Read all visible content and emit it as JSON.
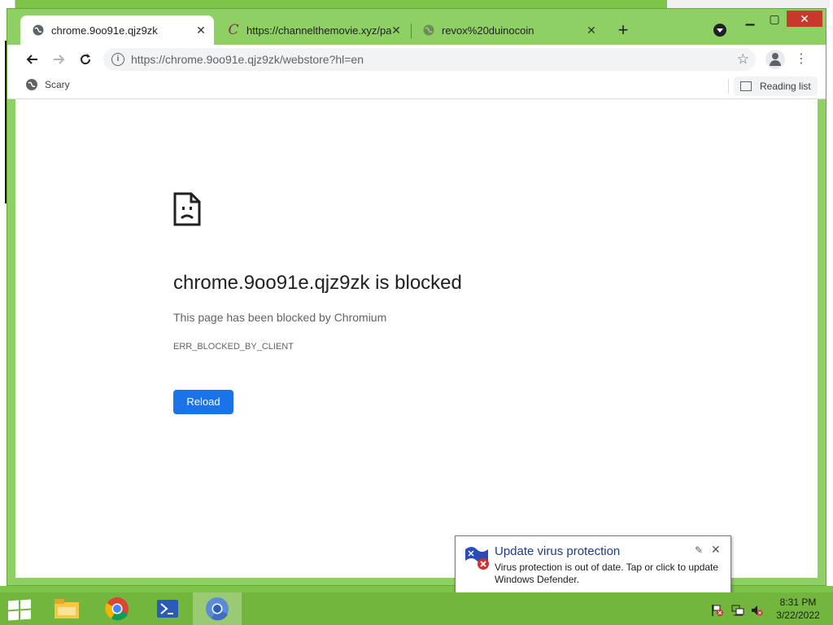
{
  "tabs": [
    {
      "title": "chrome.9oo91e.qjz9zk",
      "active": true,
      "favicon": "globe-icon"
    },
    {
      "title": "https://channelthemovie.xyz/pag",
      "active": false,
      "favicon": "channel-c-icon"
    },
    {
      "title": "revox%20duinocoin",
      "active": false,
      "favicon": "globe-icon"
    }
  ],
  "toolbar": {
    "url": "https://chrome.9oo91e.qjz9zk/webstore?hl=en"
  },
  "bookmarks": {
    "item": "Scary",
    "reading_list": "Reading list"
  },
  "error": {
    "title": "chrome.9oo91e.qjz9zk is blocked",
    "description": "This page has been blocked by Chromium",
    "code": "ERR_BLOCKED_BY_CLIENT",
    "reload_label": "Reload"
  },
  "notification": {
    "title": "Update virus protection",
    "body": "Virus protection is out of date. Tap or click to update Windows Defender."
  },
  "clock": {
    "time": "8:31 PM",
    "date": "3/22/2022"
  },
  "colors": {
    "accent": "#1a73e8",
    "desktop": "#7cc548"
  }
}
